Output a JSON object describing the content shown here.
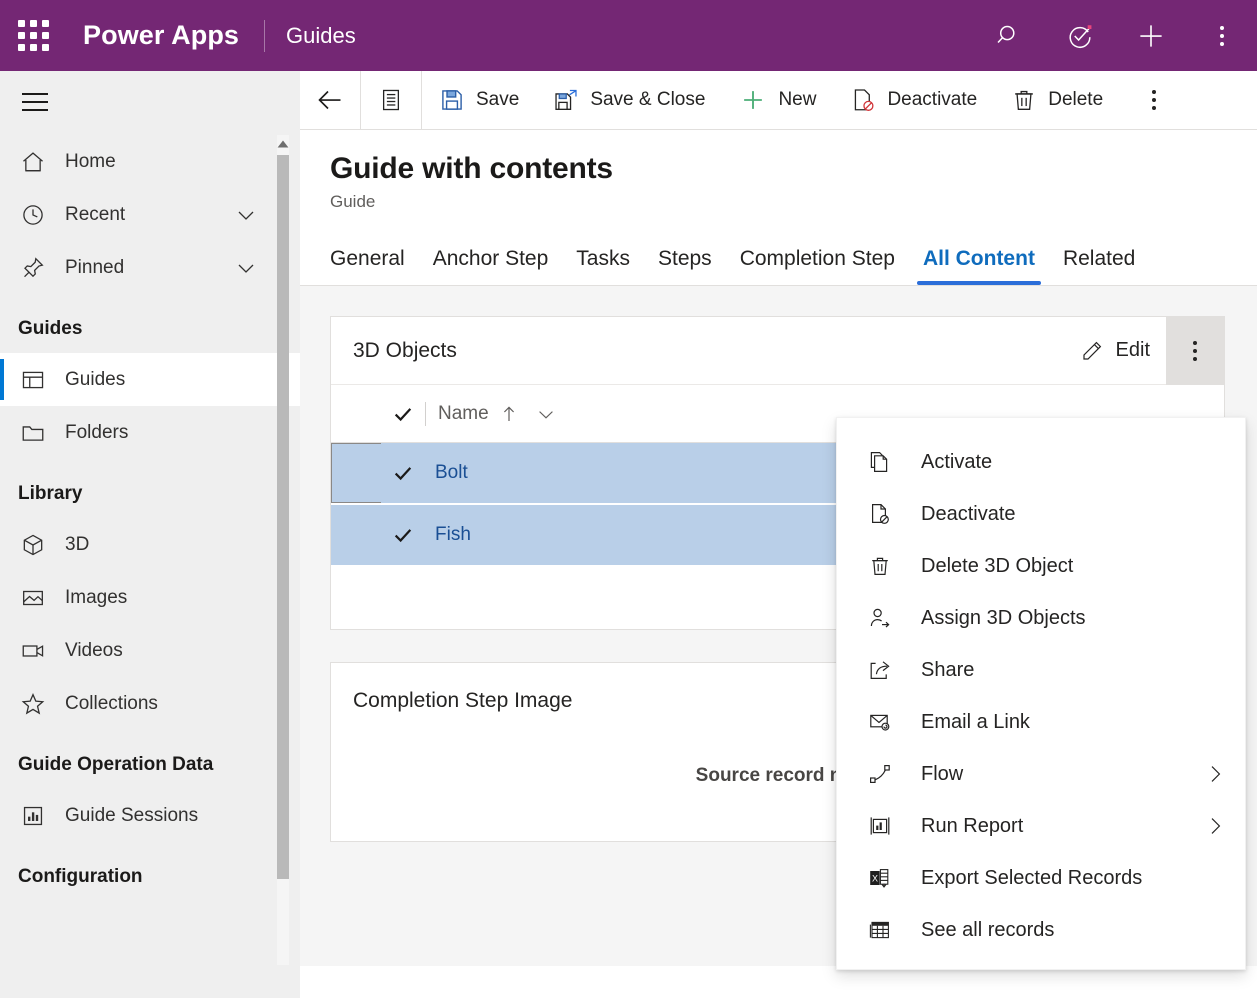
{
  "brand": {
    "waffle_icon": "app-launcher-icon",
    "name": "Power Apps",
    "app": "Guides",
    "actions": [
      {
        "icon": "search-icon",
        "name": "search-button"
      },
      {
        "icon": "assistant-icon",
        "name": "assistant-button"
      },
      {
        "icon": "plus-icon",
        "name": "new-button"
      },
      {
        "icon": "kebab-icon",
        "name": "settings-overflow-button"
      }
    ]
  },
  "sidebar": {
    "hamburger_icon": "hamburger-icon",
    "items": [
      {
        "label": "Home",
        "icon": "home-icon",
        "chevron": false,
        "active": false
      },
      {
        "label": "Recent",
        "icon": "clock-icon",
        "chevron": true,
        "active": false
      },
      {
        "label": "Pinned",
        "icon": "pin-icon",
        "chevron": true,
        "active": false
      }
    ],
    "groups": [
      {
        "title": "Guides",
        "items": [
          {
            "label": "Guides",
            "icon": "guides-icon",
            "active": true
          },
          {
            "label": "Folders",
            "icon": "folder-icon",
            "active": false
          }
        ]
      },
      {
        "title": "Library",
        "items": [
          {
            "label": "3D",
            "icon": "cube-icon",
            "active": false
          },
          {
            "label": "Images",
            "icon": "image-icon",
            "active": false
          },
          {
            "label": "Videos",
            "icon": "video-icon",
            "active": false
          },
          {
            "label": "Collections",
            "icon": "star-icon",
            "active": false
          }
        ]
      },
      {
        "title": "Guide Operation Data",
        "items": [
          {
            "label": "Guide Sessions",
            "icon": "chart-icon",
            "active": false
          }
        ]
      },
      {
        "title": "Configuration",
        "items": []
      }
    ]
  },
  "commandbar": {
    "back_icon": "back-arrow-icon",
    "form_selector_icon": "form-selector-icon",
    "buttons": [
      {
        "label": "Save",
        "icon": "save-icon"
      },
      {
        "label": "Save & Close",
        "icon": "save-close-icon"
      },
      {
        "label": "New",
        "icon": "plus-icon"
      },
      {
        "label": "Deactivate",
        "icon": "deactivate-icon"
      },
      {
        "label": "Delete",
        "icon": "trash-icon"
      }
    ],
    "overflow_icon": "kebab-icon"
  },
  "record": {
    "title": "Guide with contents",
    "subtitle": "Guide"
  },
  "tabs": [
    {
      "label": "General",
      "selected": false
    },
    {
      "label": "Anchor Step",
      "selected": false
    },
    {
      "label": "Tasks",
      "selected": false
    },
    {
      "label": "Steps",
      "selected": false
    },
    {
      "label": "Completion Step",
      "selected": false
    },
    {
      "label": "All Content",
      "selected": true
    },
    {
      "label": "Related",
      "selected": false
    }
  ],
  "objects_card": {
    "title": "3D Objects",
    "edit_label": "Edit",
    "edit_icon": "pencil-icon",
    "kebab_icon": "kebab-icon",
    "grid": {
      "select_all_icon": "checkmark-icon",
      "column": "Name",
      "sort_icon": "sort-ascending-arrow-icon",
      "column_chevron_icon": "chevron-down-icon",
      "rows": [
        {
          "name": "Bolt",
          "selected": true,
          "focused": true
        },
        {
          "name": "Fish",
          "selected": true,
          "focused": false
        }
      ]
    }
  },
  "completion_card": {
    "title": "Completion Step Image",
    "message": "Source record not"
  },
  "context_menu": {
    "items": [
      {
        "label": "Activate",
        "icon": "activate-icon",
        "submenu": false
      },
      {
        "label": "Deactivate",
        "icon": "deactivate-icon",
        "submenu": false
      },
      {
        "label": "Delete 3D Object",
        "icon": "trash-icon",
        "submenu": false
      },
      {
        "label": "Assign 3D Objects",
        "icon": "assign-person-icon",
        "submenu": false
      },
      {
        "label": "Share",
        "icon": "share-icon",
        "submenu": false
      },
      {
        "label": "Email a Link",
        "icon": "email-link-icon",
        "submenu": false
      },
      {
        "label": "Flow",
        "icon": "flow-icon",
        "submenu": true
      },
      {
        "label": "Run Report",
        "icon": "report-icon",
        "submenu": true
      },
      {
        "label": "Export Selected Records",
        "icon": "excel-export-icon",
        "submenu": false
      },
      {
        "label": "See all records",
        "icon": "table-icon",
        "submenu": false
      }
    ],
    "submenu_icon": "chevron-right-icon"
  },
  "colors": {
    "brand_purple": "#742774",
    "accent_blue": "#2b6ed9",
    "link_blue": "#1a4f94",
    "row_selected": "#b9cfe8",
    "canvas_gray": "#f5f5f5"
  }
}
